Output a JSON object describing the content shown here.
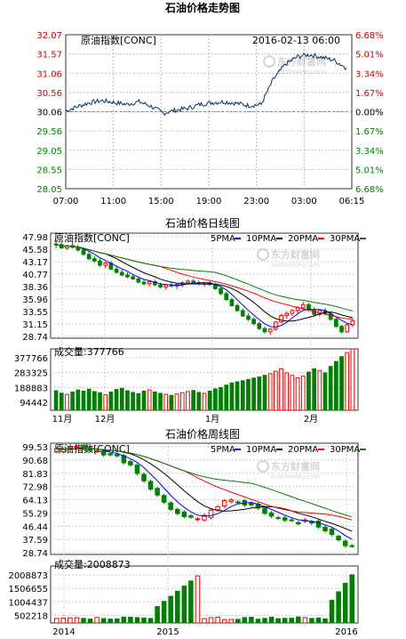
{
  "page_title": "石油价格走势图",
  "watermark": {
    "brand": "东方财富网",
    "url": "eastmoney.com"
  },
  "intraday": {
    "label": "原油指数[CONC]",
    "datetime": "2016-02-13 06:00",
    "price_ticks": [
      "32.07",
      "31.57",
      "31.06",
      "30.56",
      "30.06",
      "29.56",
      "29.05",
      "28.55",
      "28.05"
    ],
    "pct_ticks": [
      "6.68%",
      "5.01%",
      "3.34%",
      "1.67%",
      "0.00%",
      "1.67%",
      "3.34%",
      "5.01%",
      "6.68%"
    ],
    "time_ticks": [
      "07:00",
      "11:00",
      "15:00",
      "19:00",
      "23:00",
      "03:00",
      "06:15"
    ]
  },
  "daily": {
    "title": "石油价格日线图",
    "label": "原油指数[CONC]",
    "ma_legend": [
      "5PMA",
      "10PMA",
      "20PMA",
      "30PMA"
    ],
    "price_ticks": [
      "47.98",
      "45.58",
      "43.17",
      "40.77",
      "38.36",
      "35.96",
      "33.55",
      "31.15",
      "28.74"
    ],
    "volume_label": "成交量:377766",
    "volume_ticks": [
      "377766",
      "283325",
      "188883",
      "94442"
    ],
    "month_ticks": [
      "11月",
      "12月",
      "1月",
      "2月"
    ]
  },
  "weekly": {
    "title": "石油价格周线图",
    "label": "原油指数[CONC]",
    "ma_legend": [
      "5PMA",
      "10PMA",
      "20PMA",
      "30PMA"
    ],
    "price_ticks": [
      "99.53",
      "90.68",
      "81.83",
      "72.98",
      "64.13",
      "55.29",
      "46.44",
      "37.59",
      "28.74"
    ],
    "volume_label": "成交量:2008873",
    "volume_ticks": [
      "2008873",
      "1506655",
      "1004437",
      "502218"
    ],
    "year_ticks": [
      "2014",
      "2015",
      "2016"
    ]
  },
  "colors": {
    "up": "#ff0000",
    "down": "#008000",
    "ma5": "#0000ff",
    "ma10": "#000000",
    "ma20": "#ff0000",
    "ma30": "#008000",
    "intraday_line": "#003366",
    "axis_red": "#cc0000",
    "axis_green": "#008000"
  },
  "chart_data": [
    {
      "type": "line",
      "title": "原油指数[CONC]",
      "x": [
        "07:00",
        "08:00",
        "09:00",
        "10:00",
        "11:00",
        "12:00",
        "13:00",
        "14:00",
        "15:00",
        "16:00",
        "17:00",
        "18:00",
        "19:00",
        "20:00",
        "21:00",
        "22:00",
        "23:00",
        "00:00",
        "01:00",
        "02:00",
        "03:00",
        "04:00",
        "05:00",
        "06:00"
      ],
      "series": [
        {
          "values": [
            30.08,
            30.2,
            30.3,
            30.35,
            30.3,
            30.25,
            30.32,
            30.2,
            30.02,
            30.1,
            30.15,
            30.25,
            30.3,
            30.32,
            30.28,
            30.22,
            30.25,
            30.9,
            31.3,
            31.5,
            31.55,
            31.48,
            31.4,
            31.2
          ]
        }
      ],
      "ylim": [
        28.05,
        32.07
      ],
      "ref_value": 30.06
    },
    {
      "type": "bar",
      "title": "石油价格日线图",
      "categories": [
        "11月",
        "12月",
        "1月",
        "2月"
      ],
      "series": [
        {
          "name": "5PMA"
        },
        {
          "name": "10PMA"
        },
        {
          "name": "20PMA"
        },
        {
          "name": "30PMA"
        }
      ],
      "ylim": [
        28.74,
        47.98
      ],
      "volume_ylim": [
        0,
        377766
      ],
      "candles": [
        [
          46.0,
          46.8,
          45.2,
          45.9
        ],
        [
          45.9,
          46.5,
          45.1,
          45.3
        ],
        [
          45.3,
          45.8,
          44.9,
          45.7
        ],
        [
          45.7,
          46.3,
          45.2,
          45.4
        ],
        [
          45.4,
          45.9,
          44.6,
          44.9
        ],
        [
          44.9,
          45.4,
          43.9,
          44.1
        ],
        [
          44.1,
          44.6,
          43.0,
          43.3
        ],
        [
          43.3,
          43.8,
          42.6,
          42.9
        ],
        [
          42.9,
          43.4,
          41.8,
          42.1
        ],
        [
          42.1,
          42.8,
          41.6,
          42.5
        ],
        [
          42.5,
          42.9,
          41.2,
          41.4
        ],
        [
          41.4,
          41.9,
          40.6,
          40.8
        ],
        [
          40.8,
          41.3,
          40.1,
          40.3
        ],
        [
          40.3,
          40.8,
          39.7,
          40.0
        ],
        [
          40.0,
          40.4,
          39.4,
          39.6
        ],
        [
          39.6,
          40.0,
          38.8,
          39.0
        ],
        [
          39.0,
          39.5,
          38.4,
          38.7
        ],
        [
          38.7,
          39.3,
          38.2,
          39.1
        ],
        [
          39.1,
          39.4,
          38.3,
          38.5
        ],
        [
          38.5,
          38.9,
          37.9,
          38.1
        ],
        [
          38.1,
          38.7,
          37.6,
          38.5
        ],
        [
          38.5,
          39.0,
          38.0,
          38.3
        ],
        [
          38.3,
          38.8,
          37.7,
          38.6
        ],
        [
          38.6,
          39.2,
          38.1,
          38.9
        ],
        [
          38.9,
          39.5,
          38.5,
          39.2
        ],
        [
          39.2,
          39.6,
          38.7,
          38.9
        ],
        [
          38.9,
          39.3,
          38.4,
          38.7
        ],
        [
          38.7,
          39.1,
          38.2,
          38.9
        ],
        [
          38.9,
          39.2,
          38.3,
          38.6
        ],
        [
          38.6,
          38.9,
          37.6,
          37.8
        ],
        [
          37.8,
          38.2,
          36.6,
          36.9
        ],
        [
          36.9,
          37.3,
          35.6,
          35.8
        ],
        [
          35.8,
          36.2,
          34.5,
          34.7
        ],
        [
          34.7,
          35.1,
          33.6,
          33.8
        ],
        [
          33.8,
          34.2,
          32.6,
          32.8
        ],
        [
          32.8,
          33.3,
          31.9,
          32.2
        ],
        [
          32.2,
          32.6,
          31.1,
          31.4
        ],
        [
          31.4,
          31.8,
          30.2,
          30.5
        ],
        [
          30.5,
          30.9,
          29.6,
          29.9
        ],
        [
          29.9,
          30.6,
          29.3,
          30.4
        ],
        [
          30.4,
          31.9,
          30.1,
          31.7
        ],
        [
          31.7,
          33.2,
          31.5,
          32.9
        ],
        [
          32.9,
          33.6,
          32.3,
          33.3
        ],
        [
          33.3,
          34.1,
          32.8,
          33.8
        ],
        [
          33.8,
          34.6,
          33.2,
          34.3
        ],
        [
          34.3,
          35.4,
          33.9,
          34.9
        ],
        [
          34.9,
          35.2,
          33.6,
          33.9
        ],
        [
          33.9,
          34.4,
          32.8,
          33.1
        ],
        [
          33.1,
          34.0,
          32.7,
          33.8
        ],
        [
          33.8,
          34.3,
          32.9,
          33.2
        ],
        [
          33.2,
          33.6,
          31.9,
          32.2
        ],
        [
          32.2,
          32.6,
          30.6,
          30.9
        ],
        [
          30.9,
          31.2,
          29.6,
          29.9
        ],
        [
          29.9,
          31.5,
          29.7,
          31.2
        ],
        [
          31.2,
          32.3,
          30.8,
          31.9
        ]
      ],
      "volumes": [
        120000,
        105000,
        98000,
        112000,
        125000,
        118000,
        130000,
        115000,
        108000,
        95000,
        112000,
        128000,
        135000,
        120000,
        110000,
        102000,
        118000,
        125000,
        112000,
        104000,
        98000,
        92000,
        100000,
        108000,
        115000,
        122000,
        110000,
        104000,
        118000,
        132000,
        140000,
        155000,
        168000,
        175000,
        182000,
        190000,
        198000,
        205000,
        215000,
        225000,
        240000,
        255000,
        230000,
        215000,
        200000,
        210000,
        235000,
        255000,
        245000,
        230000,
        270000,
        300000,
        330000,
        355000,
        377766
      ]
    },
    {
      "type": "bar",
      "title": "石油价格周线图",
      "categories": [
        "2014",
        "2015",
        "2016"
      ],
      "series": [
        {
          "name": "5PMA"
        },
        {
          "name": "10PMA"
        },
        {
          "name": "20PMA"
        },
        {
          "name": "30PMA"
        }
      ],
      "ylim": [
        28.74,
        99.53
      ],
      "volume_ylim": [
        0,
        2008873
      ]
    }
  ]
}
